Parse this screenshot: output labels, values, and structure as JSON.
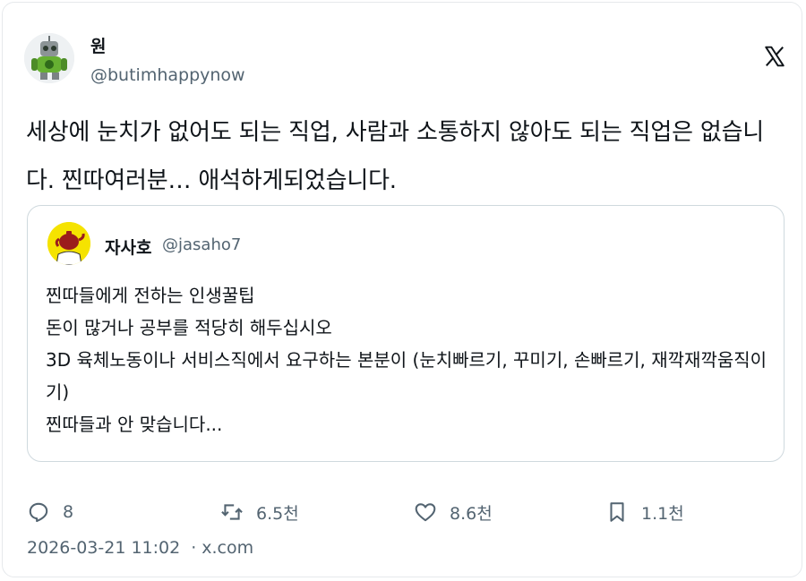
{
  "author": {
    "display_name": "원",
    "handle": "@butimhappynow"
  },
  "tweet": {
    "text": "세상에 눈치가 없어도 되는 직업, 사람과 소통하지 않아도 되는 직업은 없습니다. 찐따여러분… 애석하게되었습니다."
  },
  "quote": {
    "display_name": "자사호",
    "handle": "@jasaho7",
    "lines": [
      "찐따들에게 전하는 인생꿀팁",
      "돈이 많거나 공부를 적당히 해두십시오",
      "3D 육체노동이나 서비스직에서 요구하는 본분이 (눈치빠르기, 꾸미기, 손빠르기, 재깍재깍움직이기)",
      "찐따들과 안 맞습니다..."
    ]
  },
  "actions": {
    "reply_count": "8",
    "retweet_count": "6.5천",
    "like_count": "8.6천",
    "bookmark_count": "1.1천"
  },
  "meta": {
    "timestamp": "2026-03-21 11:02",
    "separator": "·",
    "source": "x.com"
  },
  "icons": {
    "logo": "x-logo-icon",
    "reply": "reply-icon",
    "retweet": "retweet-icon",
    "like": "heart-icon",
    "bookmark": "bookmark-icon"
  },
  "colors": {
    "text": "#0f1419",
    "secondary": "#536471",
    "border": "#cfd9de",
    "quote_avatar_bg": "#f5e300"
  }
}
